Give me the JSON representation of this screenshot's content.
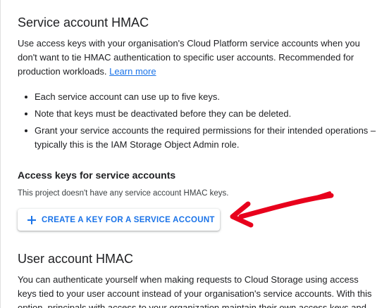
{
  "service_section": {
    "title": "Service account HMAC",
    "intro": "Use access keys with your organisation's Cloud Platform service accounts when you don't want to tie HMAC authentication to specific user accounts. Recommended for production workloads.",
    "learn_more": "Learn more",
    "bullets": [
      "Each service account can use up to five keys.",
      "Note that keys must be deactivated before they can be deleted.",
      "Grant your service accounts the required permissions for their intended operations – typically this is the IAM Storage Object Admin role."
    ],
    "access_keys_title": "Access keys for service accounts",
    "empty_message": "This project doesn't have any service account HMAC keys.",
    "create_button": "CREATE A KEY FOR A SERVICE ACCOUNT"
  },
  "user_section": {
    "title": "User account HMAC",
    "intro": "You can authenticate yourself when making requests to Cloud Storage using access keys tied to your user account instead of your organisation's service accounts. With this option, principals with access to your organization maintain their own access keys and"
  },
  "colors": {
    "accent": "#1a73e8",
    "annotation_arrow": "#e8001c"
  },
  "icons": {
    "create_button_icon": "plus-icon",
    "annotation": "red-arrow-annotation"
  }
}
